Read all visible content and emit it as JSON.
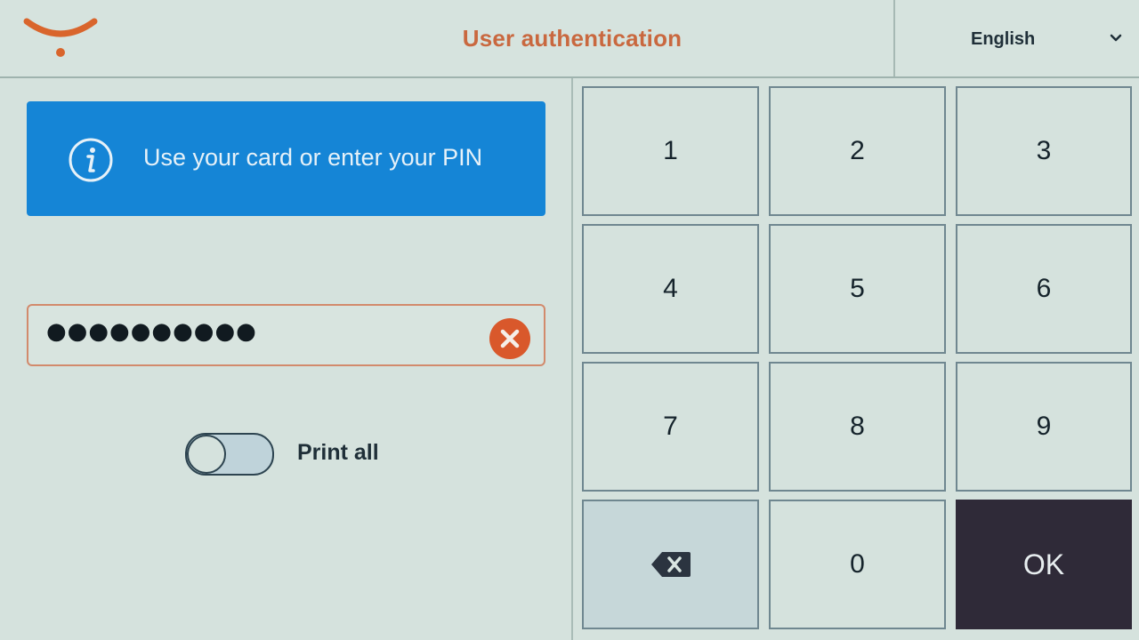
{
  "header": {
    "title": "User authentication",
    "language": {
      "selected": "English",
      "icon": "chevron-down-icon"
    },
    "logo_icon": "brand-logo",
    "accent_color": "#c9683f"
  },
  "info_banner": {
    "icon": "info-icon",
    "text": "Use your card or enter your PIN",
    "color": "#1585d6"
  },
  "pin_input": {
    "masked_value": "●●●●●●●●●●",
    "clear_icon": "clear-icon",
    "clear_color": "#d9582b"
  },
  "print_all": {
    "label": "Print all",
    "enabled": false
  },
  "keypad": {
    "keys": [
      "1",
      "2",
      "3",
      "4",
      "5",
      "6",
      "7",
      "8",
      "9"
    ],
    "zero": "0",
    "backspace_icon": "backspace-icon",
    "ok": "OK"
  }
}
